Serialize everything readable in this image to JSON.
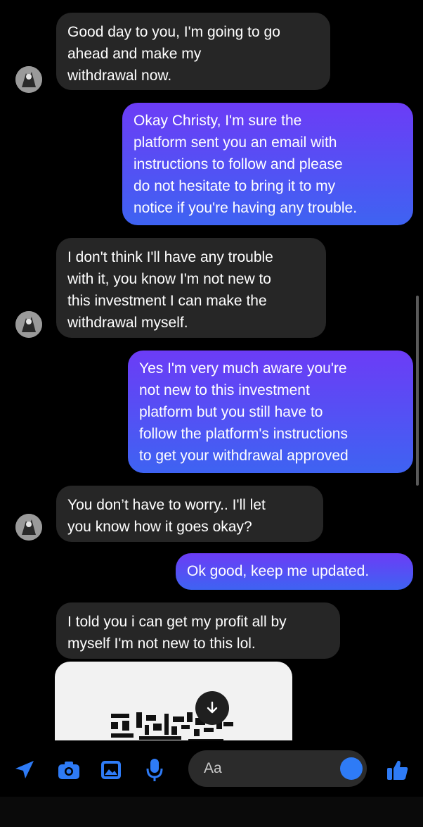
{
  "messages": [
    {
      "direction": "incoming",
      "text": "Good day to you, I'm going to go\nahead and make my\nwithdrawal now."
    },
    {
      "direction": "outgoing",
      "text": "Okay Christy, I'm sure the\nplatform sent you an email with\ninstructions to follow and please\ndo not hesitate to bring it to my\nnotice if you're having any trouble."
    },
    {
      "direction": "incoming",
      "text": "I don't think I'll have any trouble\nwith it, you know I'm not new to\nthis investment I can make the\nwithdrawal myself."
    },
    {
      "direction": "outgoing",
      "text": "Yes I'm very much aware you're\nnot new to this investment\nplatform but you still have to\nfollow the platform's instructions\nto get your withdrawal approved"
    },
    {
      "direction": "incoming",
      "text": "You don’t have to worry.. I'll let\nyou know how it goes okay?"
    },
    {
      "direction": "outgoing",
      "text": "Ok good, keep me updated."
    },
    {
      "direction": "incoming",
      "text": "I told you i can get my profit all by\nmyself I'm not new to this lol."
    }
  ],
  "composer": {
    "placeholder": "Aa",
    "icons": [
      "send-arrow-icon",
      "camera-icon",
      "gallery-icon",
      "microphone-icon",
      "emoji-icon",
      "thumbs-up-icon"
    ]
  },
  "image_message": {
    "icons": [
      "download-icon",
      "qr-code-icon"
    ]
  },
  "colors": {
    "incoming_bubble": "#262626",
    "outgoing_gradient_top": "#6c3cf6",
    "outgoing_gradient_bottom": "#3e63f2",
    "accent": "#2e7bf6"
  }
}
